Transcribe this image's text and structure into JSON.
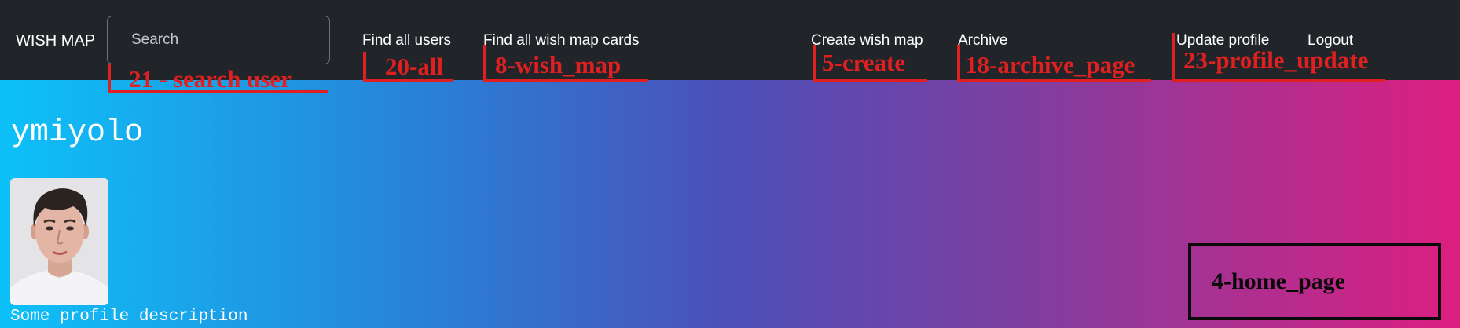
{
  "navbar": {
    "brand": "WISH MAP",
    "search_placeholder": "Search",
    "links": {
      "find_all_users": "Find all users",
      "find_all_wish_map_cards": "Find all wish map cards",
      "create_wish_map": "Create wish map",
      "archive": "Archive",
      "update_profile": "Update profile",
      "logout": "Logout"
    }
  },
  "annotations": {
    "search_user": "21 - search user",
    "all": "20-all",
    "wish_map": "8-wish_map",
    "create": "5-create",
    "archive_page": "18-archive_page",
    "profile_update": "23-profile_update",
    "home_page": "4-home_page"
  },
  "profile": {
    "username": "ymiyolo",
    "description": "Some profile description",
    "avatar_icon": "user-photo"
  },
  "colors": {
    "navbar_bg": "#212529",
    "annotation_red": "#e02020",
    "gradient_start": "#0dc1f8",
    "gradient_end": "#dc1f80"
  }
}
